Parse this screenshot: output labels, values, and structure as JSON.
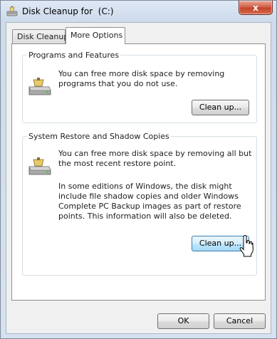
{
  "window": {
    "title": "Disk Cleanup for  (C:)",
    "close_label": "x"
  },
  "tabs": [
    {
      "label": "Disk Cleanup",
      "active": false
    },
    {
      "label": "More Options",
      "active": true
    }
  ],
  "programs_features": {
    "title": "Programs and Features",
    "description": "You can free more disk space by removing programs that you do not use.",
    "button_label": "Clean up..."
  },
  "system_restore": {
    "title": "System Restore and Shadow Copies",
    "description": "You can free more disk space by removing all but the most recent restore point.",
    "note": "In some editions of Windows, the disk might include file shadow copies and older Windows Complete PC Backup images as part of restore points. This information will also be deleted.",
    "button_label": "Clean up..."
  },
  "footer": {
    "ok_label": "OK",
    "cancel_label": "Cancel"
  },
  "icons": {
    "title": "disk-cleanup-icon",
    "programs": "hard-drive-icon",
    "restore": "hard-drive-icon",
    "pointer": "mouse-pointer-icon"
  }
}
